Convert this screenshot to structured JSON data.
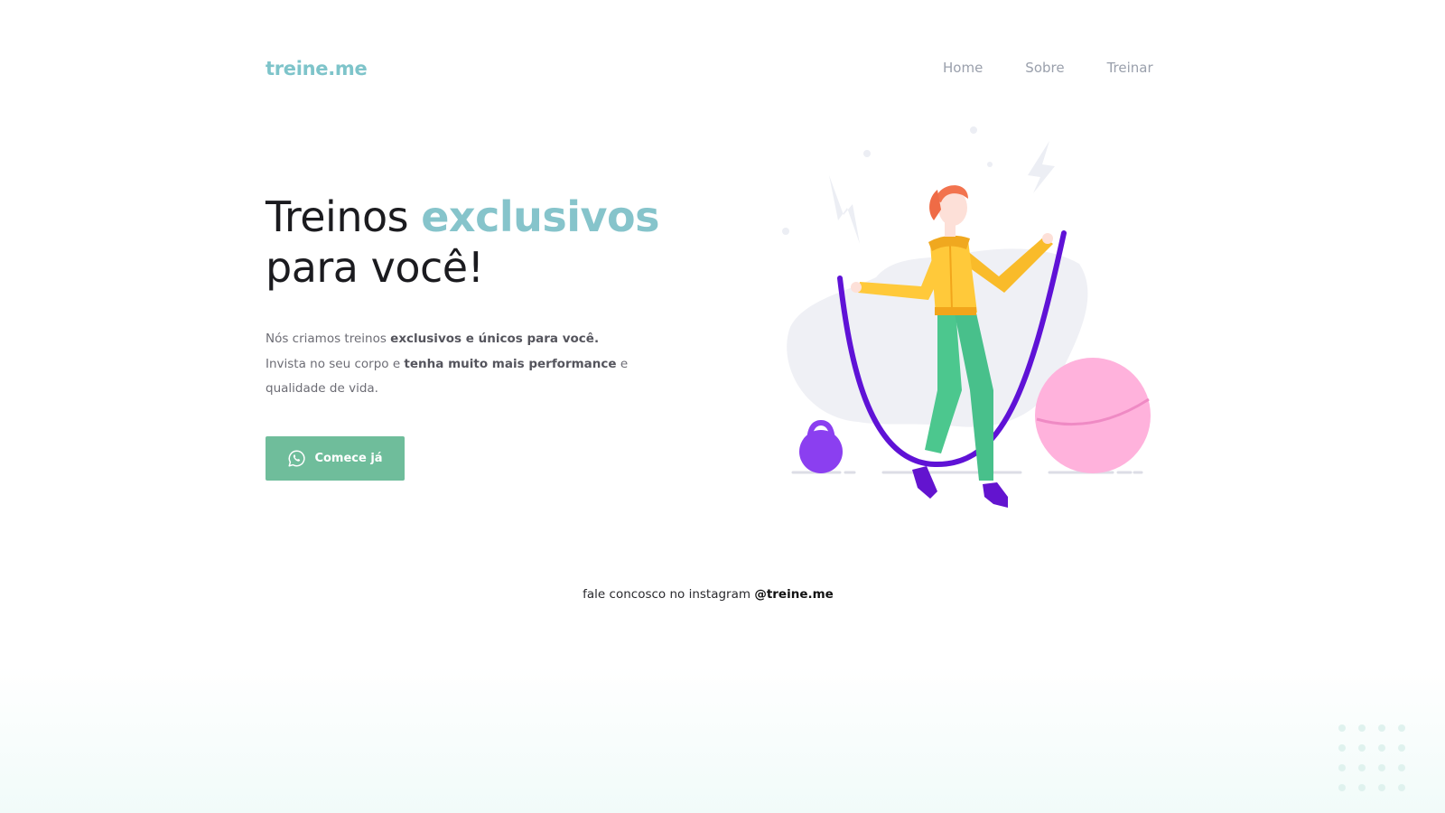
{
  "header": {
    "logo": "treine.me",
    "nav": [
      {
        "label": "Home"
      },
      {
        "label": "Sobre"
      },
      {
        "label": "Treinar"
      }
    ]
  },
  "hero": {
    "title_part1": "Treinos ",
    "title_accent": "exclusivos",
    "title_part2": "para você!",
    "desc": {
      "t1": "Nós criamos treinos ",
      "b1": "exclusivos e únicos para você.",
      "t2": "Invista no seu corpo e ",
      "b2": "tenha muito mais performance",
      "t3": " e qualidade de vida."
    },
    "cta_label": "Comece já"
  },
  "footer": {
    "text": "fale concosco no instagram ",
    "handle": "@treine.me"
  },
  "icons": {
    "cta": "whatsapp-icon",
    "illustration": "woman-jump-rope-illustration"
  },
  "colors": {
    "brand": "#7ec4ca",
    "accent": "#86c4cb",
    "cta": "#6fbd9b",
    "nav": "#9aa0ac"
  }
}
